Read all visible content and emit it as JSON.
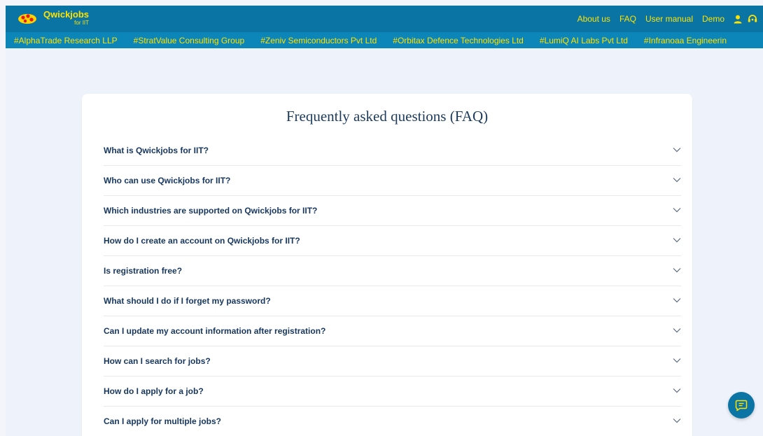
{
  "brand": {
    "name": "Qwickjobs",
    "subtitle": "for IIT"
  },
  "nav": {
    "about": "About us",
    "faq": "FAQ",
    "manual": "User manual",
    "demo": "Demo",
    "icons": [
      "user-icon",
      "support-icon"
    ]
  },
  "companies": [
    "#AlphaTrade Research LLP",
    "#StratValue Consulting Group",
    "#Zeniv Semiconductors Pvt Ltd",
    "#Orbitax Defence Technologies Ltd",
    "#LumiQ AI Labs Pvt Ltd",
    "#Infranoaa Engineerin"
  ],
  "faq": {
    "title": "Frequently asked questions (FAQ)",
    "questions": [
      "What is Qwickjobs for IIT?",
      "Who can use Qwickjobs for IIT?",
      "Which industries are supported on Qwickjobs for IIT?",
      "How do I create an account on Qwickjobs for IIT?",
      "Is registration free?",
      "What should I do if I forget my password?",
      "Can I update my account information after registration?",
      "How can I search for jobs?",
      "How do I apply for a job?",
      "Can I apply for multiple jobs?"
    ]
  },
  "chat": {
    "icon": "chat-icon"
  },
  "colors": {
    "header": "#0a74a4",
    "companies_bar": "#0c85b8",
    "link_yellow": "#ffe300",
    "question_text": "#16365e",
    "page_bg": "#eef2fa"
  }
}
